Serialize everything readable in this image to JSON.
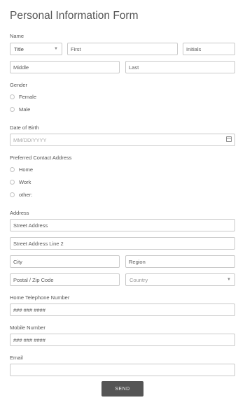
{
  "form": {
    "title": "Personal Information Form",
    "name": {
      "label": "Name",
      "title_select": "Title",
      "first_placeholder": "First",
      "initials_placeholder": "Initials",
      "middle_placeholder": "Middle",
      "last_placeholder": "Last"
    },
    "gender": {
      "label": "Gender",
      "options": [
        "Female",
        "Male"
      ]
    },
    "dob": {
      "label": "Date of Birth",
      "placeholder": "MM/DD/YYYY"
    },
    "contact": {
      "label": "Preferred Contact Address",
      "options": [
        "Home",
        "Work",
        "other:"
      ]
    },
    "address": {
      "label": "Address",
      "street_placeholder": "Street Address",
      "street2_placeholder": "Street Address Line 2",
      "city_placeholder": "City",
      "region_placeholder": "Region",
      "zip_placeholder": "Postal / Zip Code",
      "country_select": "Country"
    },
    "home_phone": {
      "label": "Home Telephone Number",
      "placeholder": "### ### ####"
    },
    "mobile": {
      "label": "Mobile Number",
      "placeholder": "### ### ####"
    },
    "email": {
      "label": "Email",
      "placeholder": ""
    },
    "send_label": "SEND"
  }
}
